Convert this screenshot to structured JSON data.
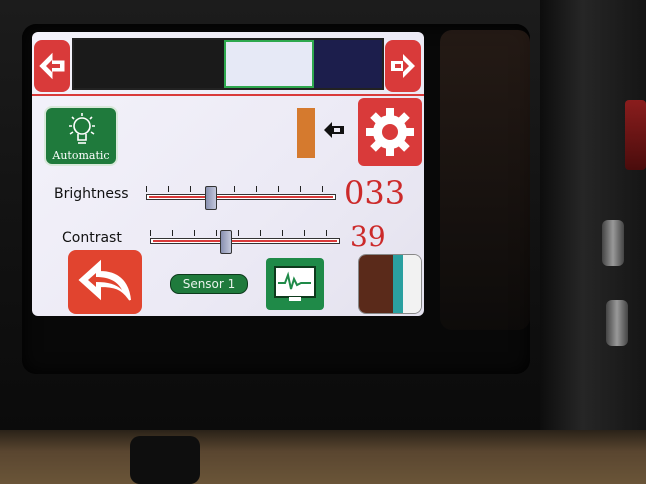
{
  "palette": {
    "accent_red": "#d93a3a",
    "accent_green": "#1f7a3c",
    "value_red": "#cc2a2a",
    "screen_bg": "#eceaf5"
  },
  "top_bar": {
    "prev_icon": "arrow-left-icon",
    "next_icon": "arrow-right-icon",
    "color_swatches": [
      "#1a1a1a",
      "#e6e9f6",
      "#1c1e4c"
    ],
    "selected_swatch_index": 1
  },
  "mode": {
    "label": "Automatic",
    "icon": "lightbulb-icon"
  },
  "settings": {
    "icon": "gear-icon",
    "current_color": "#d57a2e",
    "pointer_icon": "arrow-left-icon"
  },
  "brightness": {
    "label": "Brightness",
    "value": "033",
    "level": 0.33
  },
  "contrast": {
    "label": "Contrast",
    "value": "39",
    "level": 0.39
  },
  "bottom_bar": {
    "back_icon": "back-arrow-icon",
    "sensor_label": "Sensor 1",
    "graph_icon": "waveform-monitor-icon",
    "color_bars": [
      "#5a2a1a",
      "#2aa0a0",
      "#f2f2f2"
    ]
  }
}
